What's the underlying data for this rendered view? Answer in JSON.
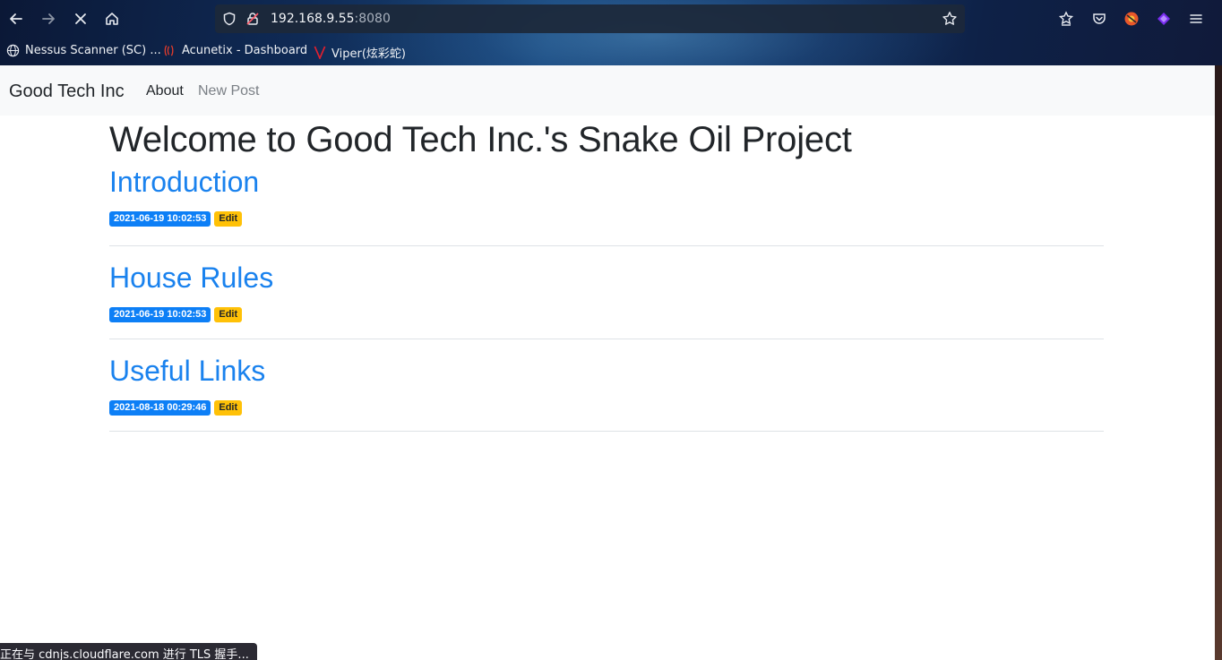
{
  "browser": {
    "url_host": "192.168.9.55",
    "url_port": ":8080",
    "bookmarks": [
      {
        "label": "Nessus Scanner (SC) ...",
        "icon": "globe-icon"
      },
      {
        "label": "Acunetix - Dashboard",
        "icon": "acunetix-icon"
      },
      {
        "label": "Viper(炫彩蛇)",
        "icon": "viper-icon"
      }
    ],
    "status_text": "正在与 cdnjs.cloudflare.com 进行 TLS 握手..."
  },
  "navbar": {
    "brand": "Good Tech Inc",
    "links": [
      {
        "label": "About",
        "active": true
      },
      {
        "label": "New Post",
        "active": false
      }
    ]
  },
  "main": {
    "title": "Welcome to Good Tech Inc.'s Snake Oil Project",
    "posts": [
      {
        "title": "Introduction",
        "date": "2021-06-19 10:02:53",
        "edit_label": "Edit"
      },
      {
        "title": "House Rules",
        "date": "2021-06-19 10:02:53",
        "edit_label": "Edit"
      },
      {
        "title": "Useful Links",
        "date": "2021-08-18 00:29:46",
        "edit_label": "Edit"
      }
    ]
  },
  "colors": {
    "link": "#1a82ee",
    "badge_date": "#0d7ff6",
    "badge_edit": "#ffc107",
    "navbar_bg": "#f8f9fa"
  }
}
